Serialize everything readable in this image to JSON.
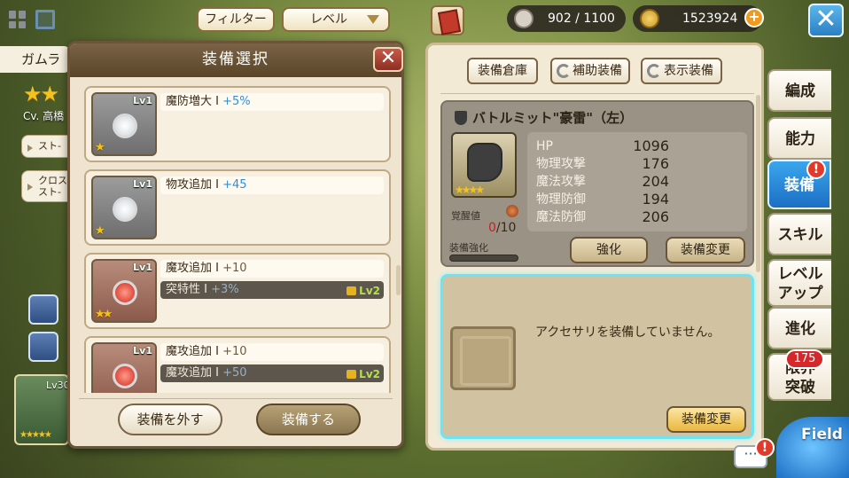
{
  "top_bar": {
    "filter_label": "フィルター",
    "level_label": "レベル",
    "stamina": "902 / 1100",
    "coins": "1523924"
  },
  "character": {
    "name_partial": "ガムラ",
    "cv_partial": "Cv. 高橋",
    "tag1": "スト-",
    "tag2_line1": "クロス",
    "tag2_line2": "スト-",
    "party_level": "Lv30",
    "party_stars": "★★★★★"
  },
  "modal": {
    "title": "装備選択",
    "items": [
      {
        "level": "Lv1",
        "stars": "★",
        "gem": "white",
        "options": [
          {
            "name": "魔防増大 I",
            "value": "+5%",
            "locked": false,
            "highlight": true
          }
        ]
      },
      {
        "level": "Lv1",
        "stars": "★",
        "gem": "white",
        "options": [
          {
            "name": "物攻追加 I",
            "value": "+45",
            "locked": false,
            "highlight": true
          }
        ]
      },
      {
        "level": "Lv1",
        "stars": "★★",
        "gem": "red",
        "options": [
          {
            "name": "魔攻追加 I",
            "value": "+10",
            "locked": false,
            "highlight": false
          },
          {
            "name": "突特性 I",
            "value": "+3%",
            "locked": true,
            "unlock": "Lv2"
          }
        ]
      },
      {
        "level": "Lv1",
        "stars": "★★",
        "gem": "red",
        "options": [
          {
            "name": "魔攻追加 I",
            "value": "+10",
            "locked": false,
            "highlight": false
          },
          {
            "name": "魔攻追加 I",
            "value": "+50",
            "locked": true,
            "unlock": "Lv2"
          }
        ]
      }
    ],
    "remove_label": "装備を外す",
    "equip_label": "装備する"
  },
  "equip_panel": {
    "tab_storage": "装備倉庫",
    "tab_support": "補助装備",
    "tab_display": "表示装備",
    "weapon_name": "バトルミット\"豪雷\"（左）",
    "weapon_stars": "★★★★",
    "awakening_label": "覚醒値",
    "awakening_current": "0",
    "awakening_max": "/10",
    "enhance_label": "装備強化",
    "stats": [
      {
        "label": "HP",
        "value": "1096"
      },
      {
        "label": "物理攻撃",
        "value": "176"
      },
      {
        "label": "魔法攻撃",
        "value": "204"
      },
      {
        "label": "物理防御",
        "value": "194"
      },
      {
        "label": "魔法防御",
        "value": "206"
      }
    ],
    "enhance_button": "強化",
    "change_button": "装備変更",
    "accessory_message": "アクセサリを装備していません。",
    "accessory_change_button": "装備変更"
  },
  "side_menu": {
    "formation": "編成",
    "ability": "能力",
    "equipment": "装備",
    "skill": "スキル",
    "levelup_line1": "レベル",
    "levelup_line2": "アップ",
    "evolution": "進化",
    "limit_line1": "限界",
    "limit_line2": "突破",
    "limit_badge": "175",
    "alert": "!",
    "field_label": "Field"
  }
}
